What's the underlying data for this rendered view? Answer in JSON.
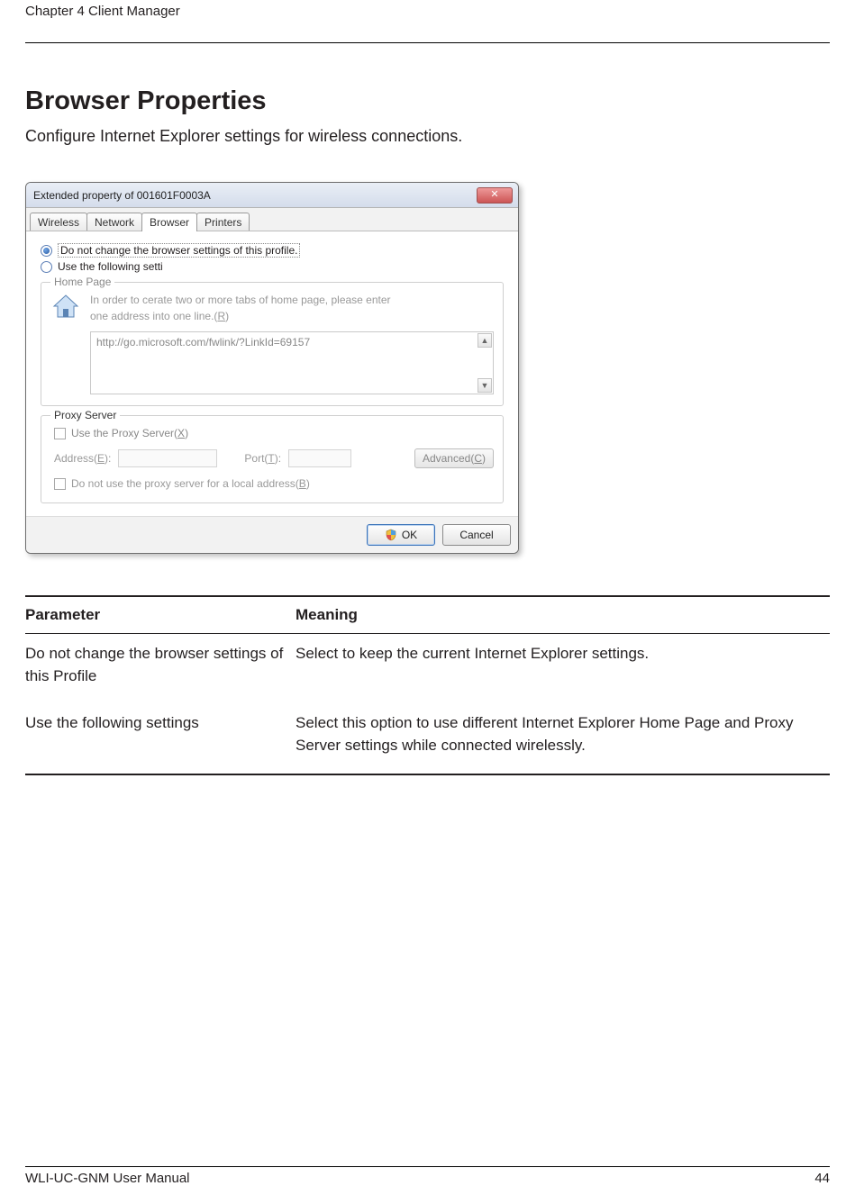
{
  "header": {
    "chapter": "Chapter 4  Client Manager"
  },
  "section": {
    "title": "Browser Properties",
    "intro": "Configure Internet Explorer settings for wireless connections."
  },
  "dialog": {
    "title": "Extended property of 001601F0003A",
    "tabs": [
      "Wireless",
      "Network",
      "Browser",
      "Printers"
    ],
    "active_tab": "Browser",
    "radio_no_change": "Do not change the browser settings of this profile.",
    "radio_use_following": "Use the following setti",
    "homepage": {
      "legend": "Home Page",
      "desc_line1": "In order to cerate two or more tabs of home page, please enter",
      "desc_line2_prefix": "one address into one line.(",
      "desc_line2_u": "R",
      "desc_line2_suffix": ")",
      "url": "http://go.microsoft.com/fwlink/?LinkId=69157"
    },
    "proxy": {
      "legend": "Proxy Server",
      "use_proxy_prefix": "Use the Proxy Server(",
      "use_proxy_u": "X",
      "use_proxy_suffix": ")",
      "address_label_prefix": "Address(",
      "address_label_u": "E",
      "address_label_suffix": "):",
      "port_label_prefix": "Port(",
      "port_label_u": "T",
      "port_label_suffix": "):",
      "advanced_prefix": "Advanced(",
      "advanced_u": "C",
      "advanced_suffix": ")",
      "no_local_prefix": "Do not use the proxy server for a local address(",
      "no_local_u": "B",
      "no_local_suffix": ")"
    },
    "buttons": {
      "ok": "OK",
      "cancel": "Cancel"
    }
  },
  "table": {
    "h_param": "Parameter",
    "h_meaning": "Meaning",
    "rows": [
      {
        "param": "Do not change the browser settings of this Profile",
        "meaning": "Select to keep the current Internet Explorer settings."
      },
      {
        "param": "Use the following settings",
        "meaning": "Select this option to use different Internet Explorer Home Page and Proxy Server settings while connected wirelessly."
      }
    ]
  },
  "footer": {
    "manual": "WLI-UC-GNM User Manual",
    "page": "44"
  }
}
